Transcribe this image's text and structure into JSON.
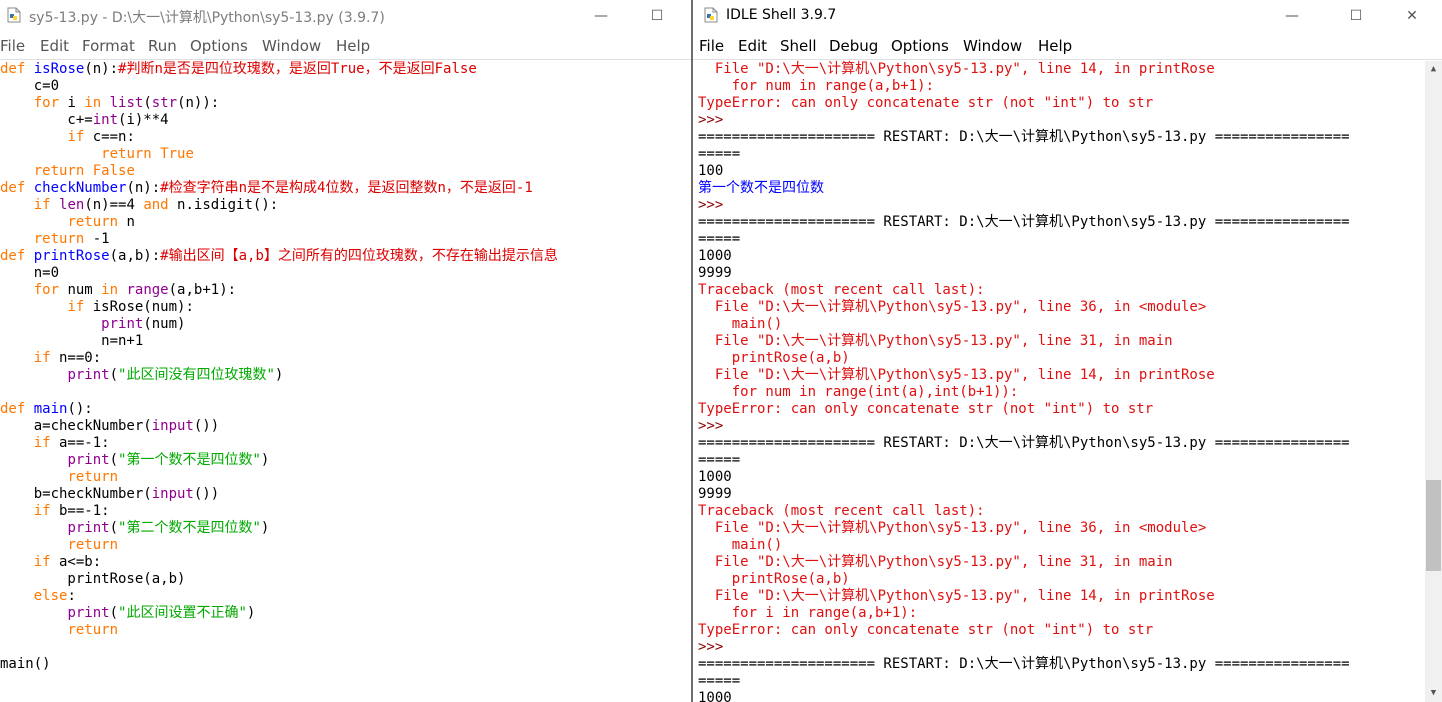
{
  "editor": {
    "title": "sy5-13.py - D:\\大一\\计算机\\Python\\sy5-13.py (3.9.7)",
    "menu": [
      "File",
      "Edit",
      "Format",
      "Run",
      "Options",
      "Window",
      "Help"
    ],
    "code": [
      [
        [
          "def",
          "kw"
        ],
        [
          " ",
          ""
        ],
        [
          "isRose",
          "df"
        ],
        [
          "(n):",
          ""
        ],
        [
          "#判断n是否是四位玫瑰数，是返回True，不是返回False",
          "cm"
        ]
      ],
      [
        [
          "    c=0",
          ""
        ]
      ],
      [
        [
          "    ",
          ""
        ],
        [
          "for",
          "kw"
        ],
        [
          " i ",
          ""
        ],
        [
          "in",
          "kw"
        ],
        [
          " ",
          ""
        ],
        [
          "list",
          "bi"
        ],
        [
          "(",
          ""
        ],
        [
          "str",
          "bi"
        ],
        [
          "(n)):",
          ""
        ]
      ],
      [
        [
          "        c+=",
          ""
        ],
        [
          "int",
          "bi"
        ],
        [
          "(i)**4",
          ""
        ]
      ],
      [
        [
          "        ",
          ""
        ],
        [
          "if",
          "kw"
        ],
        [
          " c==n:",
          ""
        ]
      ],
      [
        [
          "            ",
          ""
        ],
        [
          "return",
          "kw"
        ],
        [
          " ",
          ""
        ],
        [
          "True",
          "kw"
        ]
      ],
      [
        [
          "    ",
          ""
        ],
        [
          "return",
          "kw"
        ],
        [
          " ",
          ""
        ],
        [
          "False",
          "kw"
        ]
      ],
      [
        [
          "def",
          "kw"
        ],
        [
          " ",
          ""
        ],
        [
          "checkNumber",
          "df"
        ],
        [
          "(n):",
          ""
        ],
        [
          "#检查字符串n是不是构成4位数，是返回整数n，不是返回-1",
          "cm"
        ]
      ],
      [
        [
          "    ",
          ""
        ],
        [
          "if",
          "kw"
        ],
        [
          " ",
          ""
        ],
        [
          "len",
          "bi"
        ],
        [
          "(n)==4 ",
          ""
        ],
        [
          "and",
          "kw"
        ],
        [
          " n.isdigit():",
          ""
        ]
      ],
      [
        [
          "        ",
          ""
        ],
        [
          "return",
          "kw"
        ],
        [
          " n",
          ""
        ]
      ],
      [
        [
          "    ",
          ""
        ],
        [
          "return",
          "kw"
        ],
        [
          " -1",
          ""
        ]
      ],
      [
        [
          "def",
          "kw"
        ],
        [
          " ",
          ""
        ],
        [
          "printRose",
          "df"
        ],
        [
          "(a,b):",
          ""
        ],
        [
          "#输出区间【a,b】之间所有的四位玫瑰数，不存在输出提示信息",
          "cm"
        ]
      ],
      [
        [
          "    n=0",
          ""
        ]
      ],
      [
        [
          "    ",
          ""
        ],
        [
          "for",
          "kw"
        ],
        [
          " num ",
          ""
        ],
        [
          "in",
          "kw"
        ],
        [
          " ",
          ""
        ],
        [
          "range",
          "bi"
        ],
        [
          "(a,b+1):",
          ""
        ]
      ],
      [
        [
          "        ",
          ""
        ],
        [
          "if",
          "kw"
        ],
        [
          " isRose(num):",
          ""
        ]
      ],
      [
        [
          "            ",
          ""
        ],
        [
          "print",
          "bi"
        ],
        [
          "(num)",
          ""
        ]
      ],
      [
        [
          "            n=n+1",
          ""
        ]
      ],
      [
        [
          "    ",
          ""
        ],
        [
          "if",
          "kw"
        ],
        [
          " n==0:",
          ""
        ]
      ],
      [
        [
          "        ",
          ""
        ],
        [
          "print",
          "bi"
        ],
        [
          "(",
          ""
        ],
        [
          "\"此区间没有四位玫瑰数\"",
          "st"
        ],
        [
          ")",
          ""
        ]
      ],
      [
        [
          "",
          ""
        ]
      ],
      [
        [
          "def",
          "kw"
        ],
        [
          " ",
          ""
        ],
        [
          "main",
          "df"
        ],
        [
          "():",
          ""
        ]
      ],
      [
        [
          "    a=checkNumber(",
          ""
        ],
        [
          "input",
          "bi"
        ],
        [
          "())",
          ""
        ]
      ],
      [
        [
          "    ",
          ""
        ],
        [
          "if",
          "kw"
        ],
        [
          " a==-1:",
          ""
        ]
      ],
      [
        [
          "        ",
          ""
        ],
        [
          "print",
          "bi"
        ],
        [
          "(",
          ""
        ],
        [
          "\"第一个数不是四位数\"",
          "st"
        ],
        [
          ")",
          ""
        ]
      ],
      [
        [
          "        ",
          ""
        ],
        [
          "return",
          "kw"
        ]
      ],
      [
        [
          "    b=checkNumber(",
          ""
        ],
        [
          "input",
          "bi"
        ],
        [
          "())",
          ""
        ]
      ],
      [
        [
          "    ",
          ""
        ],
        [
          "if",
          "kw"
        ],
        [
          " b==-1:",
          ""
        ]
      ],
      [
        [
          "        ",
          ""
        ],
        [
          "print",
          "bi"
        ],
        [
          "(",
          ""
        ],
        [
          "\"第二个数不是四位数\"",
          "st"
        ],
        [
          ")",
          ""
        ]
      ],
      [
        [
          "        ",
          ""
        ],
        [
          "return",
          "kw"
        ]
      ],
      [
        [
          "    ",
          ""
        ],
        [
          "if",
          "kw"
        ],
        [
          " a<=b:",
          ""
        ]
      ],
      [
        [
          "        printRose(a,b)",
          ""
        ]
      ],
      [
        [
          "    ",
          ""
        ],
        [
          "else",
          "kw"
        ],
        [
          ":",
          ""
        ]
      ],
      [
        [
          "        ",
          ""
        ],
        [
          "print",
          "bi"
        ],
        [
          "(",
          ""
        ],
        [
          "\"此区间设置不正确\"",
          "st"
        ],
        [
          ")",
          ""
        ]
      ],
      [
        [
          "        ",
          ""
        ],
        [
          "return",
          "kw"
        ]
      ],
      [
        [
          "",
          ""
        ]
      ],
      [
        [
          "main()",
          ""
        ]
      ]
    ]
  },
  "shell": {
    "title": "IDLE Shell 3.9.7",
    "menu": [
      "File",
      "Edit",
      "Shell",
      "Debug",
      "Options",
      "Window",
      "Help"
    ],
    "lines": [
      [
        "  File \"D:\\大一\\计算机\\Python\\sy5-13.py\", line 14, in printRose",
        "err"
      ],
      [
        "    for num in range(a,b+1):",
        "err"
      ],
      [
        "TypeError: can only concatenate str (not \"int\") to str",
        "err"
      ],
      [
        ">>> ",
        "pr"
      ],
      [
        "===================== RESTART: D:\\大一\\计算机\\Python\\sy5-13.py ================",
        "out"
      ],
      [
        "=====",
        "out"
      ],
      [
        "100",
        "out"
      ],
      [
        "第一个数不是四位数",
        "so"
      ],
      [
        ">>> ",
        "pr"
      ],
      [
        "===================== RESTART: D:\\大一\\计算机\\Python\\sy5-13.py ================",
        "out"
      ],
      [
        "=====",
        "out"
      ],
      [
        "1000",
        "out"
      ],
      [
        "9999",
        "out"
      ],
      [
        "Traceback (most recent call last):",
        "err"
      ],
      [
        "  File \"D:\\大一\\计算机\\Python\\sy5-13.py\", line 36, in <module>",
        "err"
      ],
      [
        "    main()",
        "err"
      ],
      [
        "  File \"D:\\大一\\计算机\\Python\\sy5-13.py\", line 31, in main",
        "err"
      ],
      [
        "    printRose(a,b)",
        "err"
      ],
      [
        "  File \"D:\\大一\\计算机\\Python\\sy5-13.py\", line 14, in printRose",
        "err"
      ],
      [
        "    for num in range(int(a),int(b+1)):",
        "err"
      ],
      [
        "TypeError: can only concatenate str (not \"int\") to str",
        "err"
      ],
      [
        ">>> ",
        "pr"
      ],
      [
        "===================== RESTART: D:\\大一\\计算机\\Python\\sy5-13.py ================",
        "out"
      ],
      [
        "=====",
        "out"
      ],
      [
        "1000",
        "out"
      ],
      [
        "9999",
        "out"
      ],
      [
        "Traceback (most recent call last):",
        "err"
      ],
      [
        "  File \"D:\\大一\\计算机\\Python\\sy5-13.py\", line 36, in <module>",
        "err"
      ],
      [
        "    main()",
        "err"
      ],
      [
        "  File \"D:\\大一\\计算机\\Python\\sy5-13.py\", line 31, in main",
        "err"
      ],
      [
        "    printRose(a,b)",
        "err"
      ],
      [
        "  File \"D:\\大一\\计算机\\Python\\sy5-13.py\", line 14, in printRose",
        "err"
      ],
      [
        "    for i in range(a,b+1):",
        "err"
      ],
      [
        "TypeError: can only concatenate str (not \"int\") to str",
        "err"
      ],
      [
        ">>> ",
        "pr"
      ],
      [
        "===================== RESTART: D:\\大一\\计算机\\Python\\sy5-13.py ================",
        "out"
      ],
      [
        "=====",
        "out"
      ],
      [
        "1000",
        "out"
      ]
    ]
  },
  "colors": {
    "keyword": "#ff7700",
    "builtin": "#900090",
    "definition": "#0000ff",
    "comment": "#dd0000",
    "string": "#00aa00",
    "error": "#e01010",
    "stdout": "#0000ff",
    "prompt": "#8b0000"
  },
  "icons": {
    "file_icon": "python-file-icon",
    "shell_icon": "idle-shell-icon"
  },
  "scrollbar": {
    "position": 0.78,
    "visible_fraction": 0.15
  }
}
